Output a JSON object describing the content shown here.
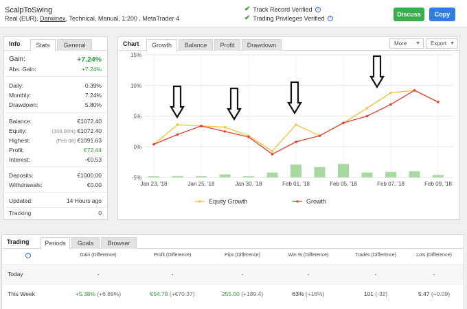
{
  "header": {
    "system_name": "ScalpToSwing",
    "meta_prefix": "Real (EUR), ",
    "broker": "Darwinex",
    "meta_suffix": ", Technical, Manual, 1:200 , MetaTrader 4",
    "verify_1": "Track Record Verified",
    "verify_2": "Trading Privileges Verified",
    "discuss_label": "Discuss",
    "copy_label": "Copy"
  },
  "info": {
    "title": "Info",
    "tabs": [
      "Stats",
      "General"
    ],
    "gain_label": "Gain:",
    "gain_value": "+7.24%",
    "abs_gain_label": "Abs. Gain:",
    "abs_gain_value": "+7.24%",
    "daily_label": "Daily:",
    "daily_value": "0.39%",
    "monthly_label": "Monthly:",
    "monthly_value": "7.24%",
    "drawdown_label": "Drawdown:",
    "drawdown_value": "5.80%",
    "balance_label": "Balance:",
    "balance_value": "€1072.40",
    "equity_label": "Equity:",
    "equity_pct": "(100.00%)",
    "equity_value": "€1072.40",
    "highest_label": "Highest:",
    "highest_date": "(Feb 08)",
    "highest_value": "€1091.63",
    "profit_label": "Profit:",
    "profit_value": "€72.44",
    "interest_label": "Interest:",
    "interest_value": "-€0.53",
    "deposits_label": "Deposits:",
    "deposits_value": "€1000.00",
    "withdrawals_label": "Withdrawals:",
    "withdrawals_value": "€0.00",
    "updated_label": "Updated:",
    "updated_value": "14 Hours ago",
    "tracking_label": "Tracking",
    "tracking_value": "0"
  },
  "chart_panel": {
    "title": "Chart",
    "tabs": [
      "Growth",
      "Balance",
      "Profit",
      "Drawdown"
    ],
    "more_label": "More",
    "export_label": "Export"
  },
  "chart_data": {
    "type": "line",
    "x_tick_labels": [
      "Jan 23, '18",
      "Jan 25, '18",
      "Jan 30, '18",
      "Feb 01, '18",
      "Feb 05, '18",
      "Feb 07, '18",
      "Feb 09, '18"
    ],
    "y_tick_labels": [
      "15%",
      "10%",
      "5%",
      "0%",
      "-5%"
    ],
    "ylim": [
      -5,
      15
    ],
    "series": [
      {
        "name": "Equity Growth",
        "color": "#f5c542",
        "values": [
          0.4,
          3.6,
          3.4,
          3.2,
          1.8,
          -0.7,
          3.6,
          1.8,
          3.9,
          6.3,
          8.8,
          9.2,
          7.3
        ]
      },
      {
        "name": "Growth",
        "color": "#e0473a",
        "values": [
          0.4,
          2.0,
          3.4,
          2.5,
          1.6,
          -1.2,
          0.8,
          1.8,
          3.9,
          5.0,
          6.9,
          9.2,
          7.3
        ]
      }
    ],
    "bars": {
      "color": "#a8d9a0",
      "values": [
        0.2,
        0.2,
        0.2,
        0.5,
        0.2,
        0.8,
        2.1,
        1.7,
        2.2,
        0.8,
        0.9,
        1.0,
        0.4
      ]
    },
    "annotation": "down-arrow",
    "annotation_count": 4,
    "grid": true,
    "legend_position": "bottom"
  },
  "trading": {
    "title": "Trading",
    "tabs": [
      "Periods",
      "Goals",
      "Browser"
    ],
    "columns": [
      "Gain (Difference)",
      "Profit (Difference)",
      "Pips (Difference)",
      "Win % (Difference)",
      "Trades (Difference)",
      "Lots (Difference)"
    ],
    "rows": [
      {
        "label": "Today",
        "gain": "-",
        "gain_diff": "",
        "profit": "-",
        "profit_diff": "",
        "pips": "-",
        "pips_diff": "",
        "win": "-",
        "win_diff": "",
        "trades": "-",
        "trades_diff": "",
        "lots": "-",
        "lots_diff": ""
      },
      {
        "label": "This Week",
        "gain": "+5.38%",
        "gain_diff": " (+6.89%)",
        "profit": "€54.78",
        "profit_diff": " (+€70.37)",
        "pips": "255.00",
        "pips_diff": " (+189.4)",
        "win": "63%",
        "win_diff": " (+16%)",
        "trades": "101",
        "trades_diff": " (-32)",
        "lots": "5.47",
        "lots_diff": " (+0.09)"
      }
    ]
  }
}
